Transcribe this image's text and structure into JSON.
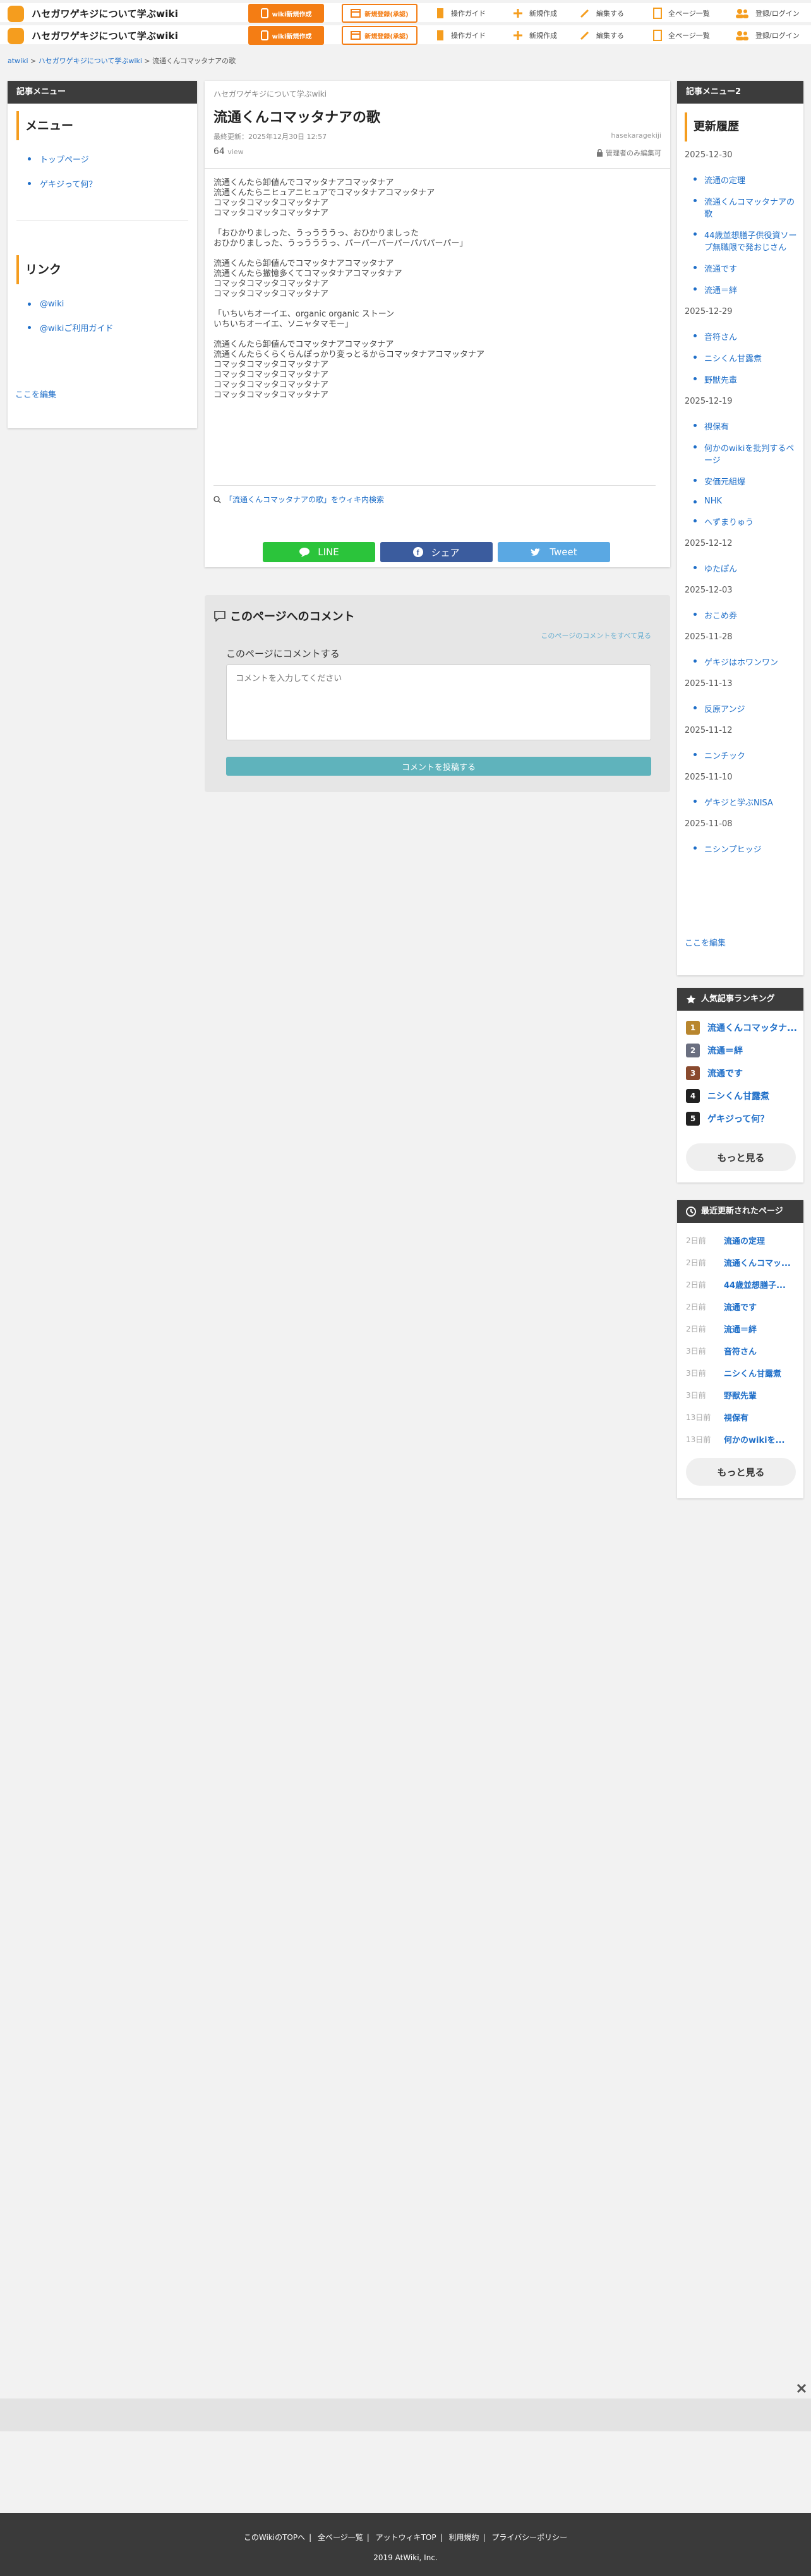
{
  "header": {
    "site_title": "ハセガワゲキジについて学ぶwiki",
    "make_wiki": "wiki新規作成",
    "member": "新規登録(承認)",
    "nav": [
      "操作ガイド",
      "新規作成",
      "編集する",
      "全ページ一覧",
      "登録/ログイン"
    ]
  },
  "breadcrumb": [
    "atwiki",
    "ハセガワゲキジについて学ぶwiki",
    "流通くんコマッタナアの歌"
  ],
  "left": {
    "head": "記事メニュー",
    "menu_title": "メニュー",
    "menu_items": [
      "トップページ",
      "ゲキジって何？"
    ],
    "link_title": "リンク",
    "link_items": [
      "@wiki",
      "@wikiご利用ガイド"
    ],
    "edit": "ここを編集"
  },
  "article": {
    "wiki_name": "ハセガワゲキジについて学ぶwiki",
    "title": "流通くんコマッタナアの歌",
    "updated": "最終更新：2025年12月30日 12:57",
    "views": "64",
    "view_unit": "view",
    "author": "hasekaragekiji",
    "admin_edit": "管理者のみ編集可",
    "body": [
      [
        "流通くんたら卸値んでコマッタナアコマッタナア",
        "流通くんたらニヒュアニヒュアでコマッタナアコマッタナア",
        "コマッタコマッタコマッタナア",
        "コマッタコマッタコマッタナア"
      ],
      [
        "「おひかりましった、うっうううっ、おひかりましった",
        "おひかりましった、うっうううっ、パーパーパーパーパパパーパー」"
      ],
      [
        "流通くんたら卸値んでコマッタナアコマッタナア",
        "流通くんたら撤憶多くてコマッタナアコマッタナア",
        "コマッタコマッタコマッタナア",
        "コマッタコマッタコマッタナア"
      ],
      [
        "「いちいちオーイエ、organic organic ストーン",
        "いちいちオーイエ、ソニャタマモー」"
      ],
      [
        "流通くんたら卸値んでコマッタナアコマッタナア",
        "流通くんたらくらくらんぽっかり変っとるからコマッタナアコマッタナア",
        "コマッタコマッタコマッタナア",
        "コマッタコマッタコマッタナア",
        "コマッタコマッタコマッタナア",
        "コマッタコマッタコマッタナア"
      ]
    ],
    "search_link": "「流通くんコマッタナアの歌」をウィキ内検索",
    "share": [
      "LINE",
      "シェア",
      "Tweet"
    ]
  },
  "comments": {
    "title": "このページへのコメント",
    "see_all": "このページのコメントをすべて見る",
    "label": "このページにコメントする",
    "placeholder": "コメントを入力してください",
    "submit": "コメントを投稿する"
  },
  "right": {
    "head": "記事メニュー2",
    "history_title": "更新履歴",
    "history": [
      {
        "date": "2025-12-30",
        "items": [
          "流通の定理",
          "流通くんコマッタナアの歌",
          "44歳並想膳子供役資ソープ無職限で発おじさん",
          "流通です",
          "流通＝絆"
        ]
      },
      {
        "date": "2025-12-29",
        "items": [
          "音符さん",
          "ニシくん甘露煮",
          "野獣先輩"
        ]
      },
      {
        "date": "2025-12-19",
        "items": [
          "視保有",
          "何かのwikiを批判するページ",
          "安価元組爆",
          "NHK",
          "へずまりゅう"
        ]
      },
      {
        "date": "2025-12-12",
        "items": [
          "ゆたぽん"
        ]
      },
      {
        "date": "2025-12-03",
        "items": [
          "おこめ券"
        ]
      },
      {
        "date": "2025-11-28",
        "items": [
          "ゲキジはホワンワン"
        ]
      },
      {
        "date": "2025-11-13",
        "items": [
          "反原アンジ"
        ]
      },
      {
        "date": "2025-11-12",
        "items": [
          "ニンチック"
        ]
      },
      {
        "date": "2025-11-10",
        "items": [
          "ゲキジと学ぶNISA"
        ]
      },
      {
        "date": "2025-11-08",
        "items": [
          "ニシンプヒッジ"
        ]
      }
    ],
    "edit": "ここを編集",
    "ranking_title": "人気記事ランキング",
    "ranking": [
      "流通くんコマッタナ...",
      "流通＝絆",
      "流通です",
      "ニシくん甘露煮",
      "ゲキジって何？"
    ],
    "ranking_colors": [
      "#b8862e",
      "#6a6f80",
      "#8a4a2e",
      "#222222",
      "#222222"
    ],
    "more": "もっと見る",
    "recent_title": "最近更新されたページ",
    "recent": [
      {
        "ago": "2日前",
        "name": "流通の定理"
      },
      {
        "ago": "2日前",
        "name": "流通くんコマッ..."
      },
      {
        "ago": "2日前",
        "name": "44歳並想膳子..."
      },
      {
        "ago": "2日前",
        "name": "流通です"
      },
      {
        "ago": "2日前",
        "name": "流通＝絆"
      },
      {
        "ago": "3日前",
        "name": "音符さん"
      },
      {
        "ago": "3日前",
        "name": "ニシくん甘露煮"
      },
      {
        "ago": "3日前",
        "name": "野獣先輩"
      },
      {
        "ago": "13日前",
        "name": "視保有"
      },
      {
        "ago": "13日前",
        "name": "何かのwikiを..."
      }
    ]
  },
  "footer": {
    "links": [
      "このWikiのTOPへ",
      "全ページ一覧",
      "アットウィキTOP",
      "利用規約",
      "プライバシーポリシー"
    ],
    "copyright": "2019 AtWiki, Inc."
  }
}
